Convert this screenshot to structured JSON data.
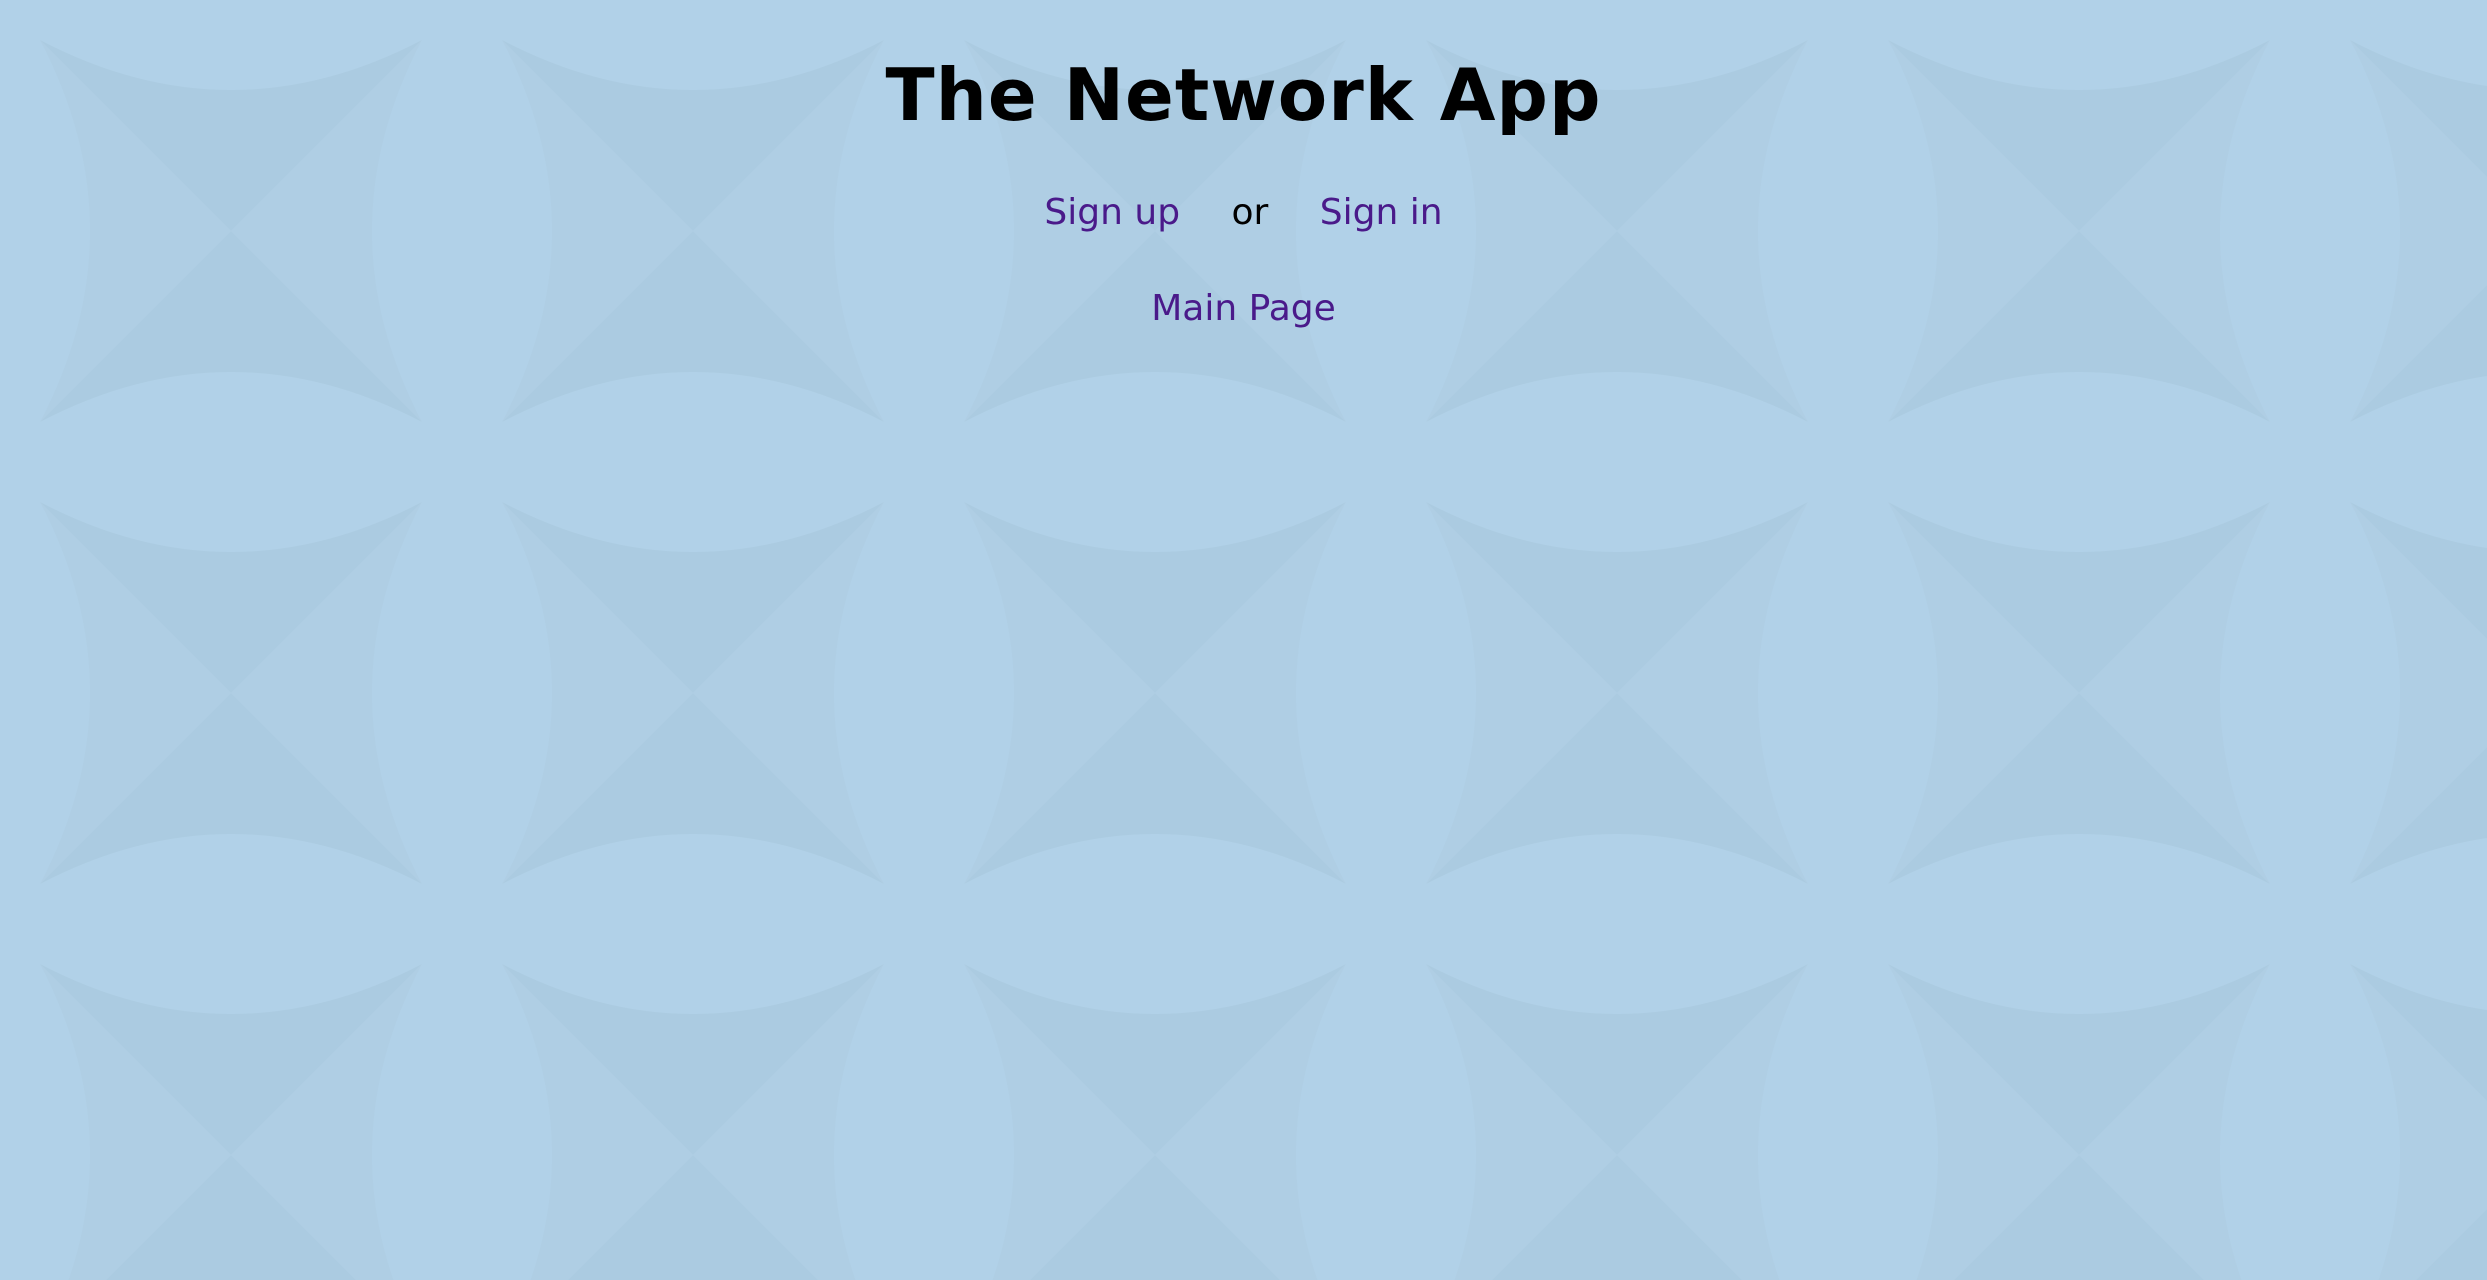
{
  "app": {
    "title": "The Network App"
  },
  "auth": {
    "signup_label": "Sign up",
    "separator": "or",
    "signin_label": "Sign in"
  },
  "nav": {
    "main_page_label": "Main Page"
  },
  "colors": {
    "background": "#b1d1e8",
    "pattern": "#a9cbdf",
    "link": "#4a1a8a",
    "text": "#000000"
  }
}
